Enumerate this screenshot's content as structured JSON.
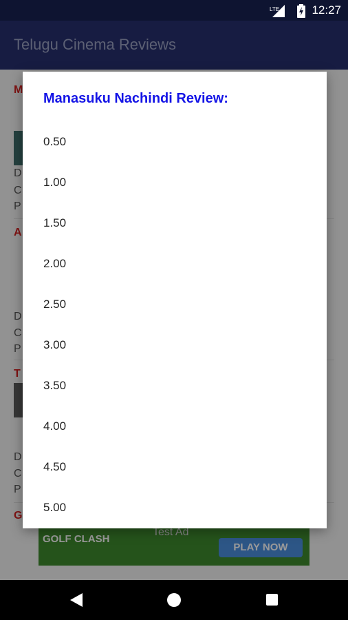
{
  "status_bar": {
    "time": "12:27",
    "signal_label": "LTE",
    "icons": [
      "lte-signal-icon",
      "battery-icon"
    ]
  },
  "app_bar": {
    "title": "Telugu Cinema Reviews"
  },
  "list": {
    "items": [
      {
        "title_initial": "M",
        "meta": [
          "D",
          "C",
          "P"
        ]
      },
      {
        "title_initial": "A",
        "meta": [
          "D",
          "C",
          "P"
        ]
      },
      {
        "title_initial": "T",
        "meta": [
          "D",
          "C",
          "P"
        ]
      },
      {
        "title_initial": "G"
      }
    ]
  },
  "ad": {
    "label": "Test Ad",
    "brand": "GOLF CLASH",
    "cta": "PLAY NOW"
  },
  "dialog": {
    "title": "Manasuku Nachindi Review:",
    "options": [
      "0.50",
      "1.00",
      "1.50",
      "2.00",
      "2.50",
      "3.00",
      "3.50",
      "4.00",
      "4.50",
      "5.00"
    ]
  },
  "nav_bar": {
    "icons": [
      "back-icon",
      "home-icon",
      "recents-icon"
    ]
  }
}
